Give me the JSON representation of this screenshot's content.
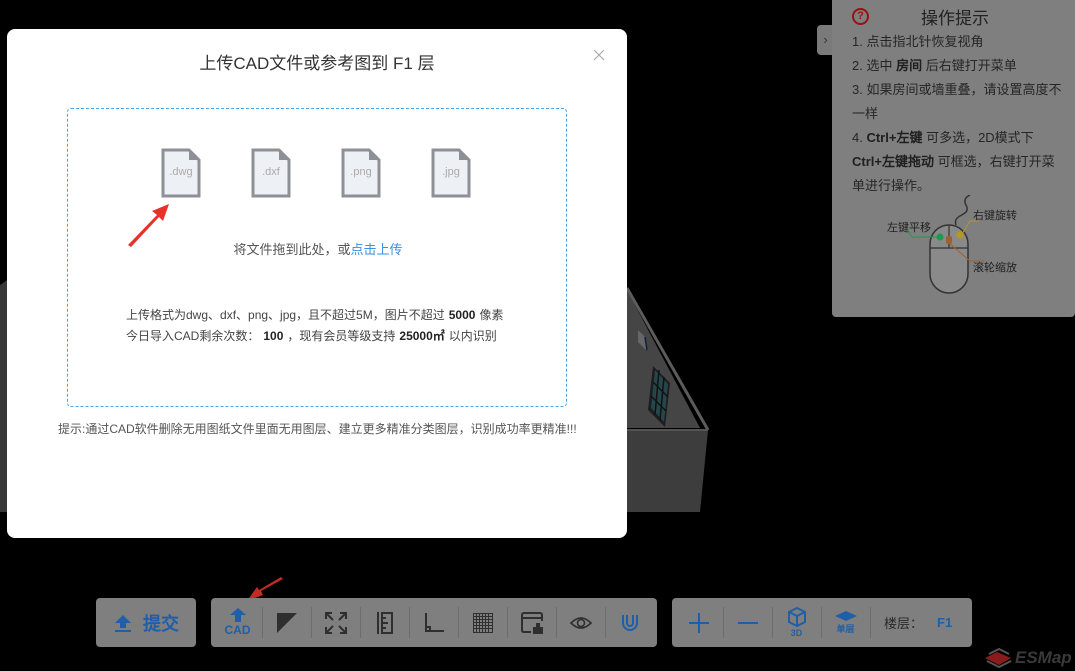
{
  "modal": {
    "title": "上传CAD文件或参考图到 F1 层",
    "close_icon": "close-icon",
    "file_types": [
      ".dwg",
      ".dxf",
      ".png",
      ".jpg"
    ],
    "drop_prefix": "将文件拖到此处，或",
    "drop_link": "点击上传",
    "info_line1_prefix": "上传格式为dwg、dxf、png、jpg，且不超过5M，图片不超过",
    "info_line1_value": "5000",
    "info_line1_suffix": "像素",
    "info_line2_prefix": "今日导入CAD剩余次数：",
    "info_line2_count": "100",
    "info_line2_mid": "，现有会员等级支持",
    "info_line2_area": "25000㎡",
    "info_line2_suffix": "以内识别",
    "tip": "提示:通过CAD软件删除无用图纸文件里面无用图层、建立更多精准分类图层，识别成功率更精准!!!"
  },
  "help": {
    "toggle_icon": "chevron-right-icon",
    "title": "操作提示",
    "l1": "1. 点击指北针恢复视角",
    "l2_a": "2. 选中 ",
    "l2_b": "房间",
    "l2_c": " 后右键打开菜单",
    "l3": "3. 如果房间或墙重叠，请设置高度不一样",
    "l4_a": "4. ",
    "l4_b": "Ctrl+左键",
    "l4_c": " 可多选，2D模式下",
    "l5_a": "Ctrl+左键拖动",
    "l5_b": " 可框选，右键打开菜单进行操作。",
    "mouse_left": "左键平移",
    "mouse_right": "右键旋转",
    "mouse_wheel": "滚轮缩放"
  },
  "toolbar": {
    "submit_label": "提交",
    "cad_label": "CAD",
    "view_3d_label": "3D",
    "single_floor_label": "单层",
    "floor_label": "楼层：",
    "floor_value": "F1"
  },
  "logo": {
    "text": "ESMap"
  },
  "colors": {
    "accent": "#1e5fa8",
    "link": "#3a8ee6",
    "dropzone_border": "#4aa3e8",
    "help_icon": "#9b1111"
  }
}
